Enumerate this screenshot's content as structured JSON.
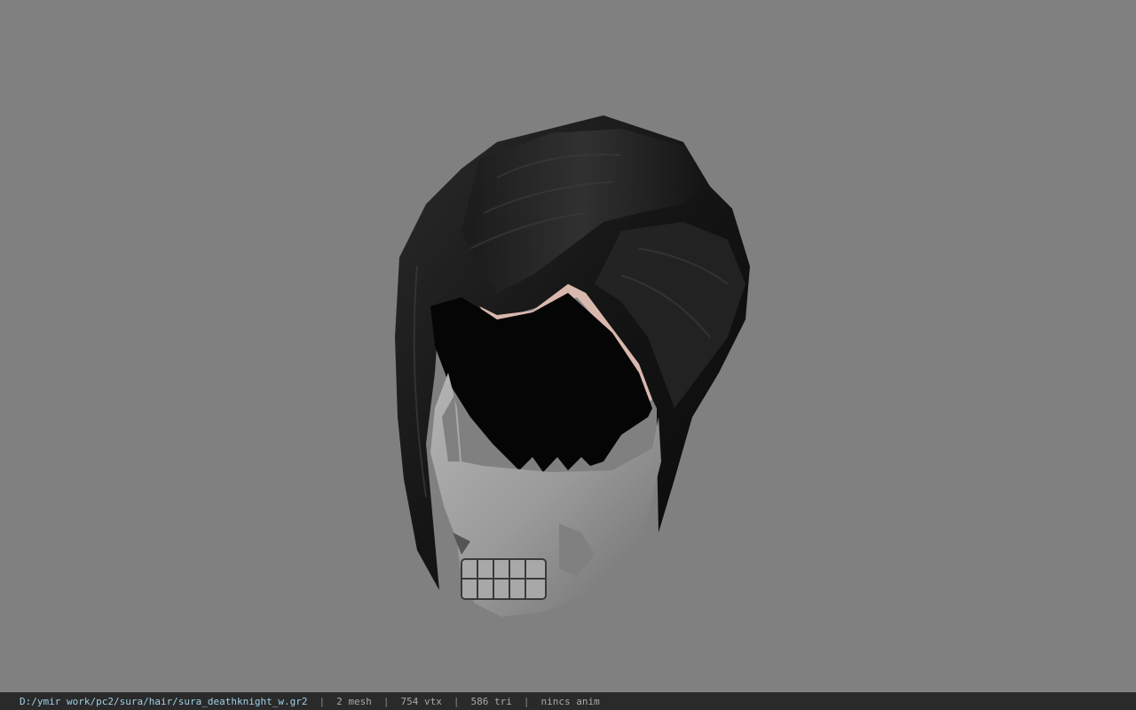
{
  "status_bar": {
    "file_path": "D:/ymir work/pc2/sura/hair/sura_deathknight_w.gr2",
    "separator": "|",
    "mesh_count": "2 mesh",
    "vertex_count": "754 vtx",
    "triangle_count": "586 tri",
    "animation": "nincs anim"
  },
  "viewport": {
    "background_color": "#808080",
    "model_icon": "hair-helmet-model-icon"
  },
  "colors": {
    "hair": "#111111",
    "mask": "#9a9a9a",
    "status_bar_bg": "#2a2a2a",
    "path_text": "#9fd0e8"
  }
}
